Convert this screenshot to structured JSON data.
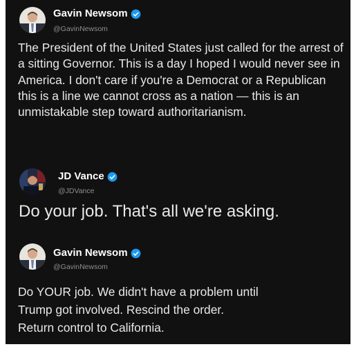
{
  "posts": [
    {
      "author": "Gavin Newsom",
      "handle": "@GavinNewsom",
      "text": "The President of the United States just called for the arrest of a sitting Governor. This is a day I hoped I would never see in America. I don't care if you're a Democrat or a Republican this is a line we cannot cross as a nation — this is an unmistakable step toward authoritarianism."
    },
    {
      "author": "JD Vance",
      "handle": "@JDVance",
      "text": "Do your job. That's all we're asking."
    },
    {
      "author": "Gavin Newsom",
      "handle": "@GavinNewsom",
      "text_lines": [
        "Do YOUR job. We didn't have a problem until",
        "Trump got involved. Rescind the order.",
        "Return control to California."
      ]
    }
  ],
  "colors": {
    "background": "#111111",
    "verified": "#1d9bf0",
    "text": "#e9e9e9",
    "handle": "#8f8f8f"
  },
  "icons": {
    "verified": "verified-badge-icon",
    "avatar": "profile-avatar"
  }
}
